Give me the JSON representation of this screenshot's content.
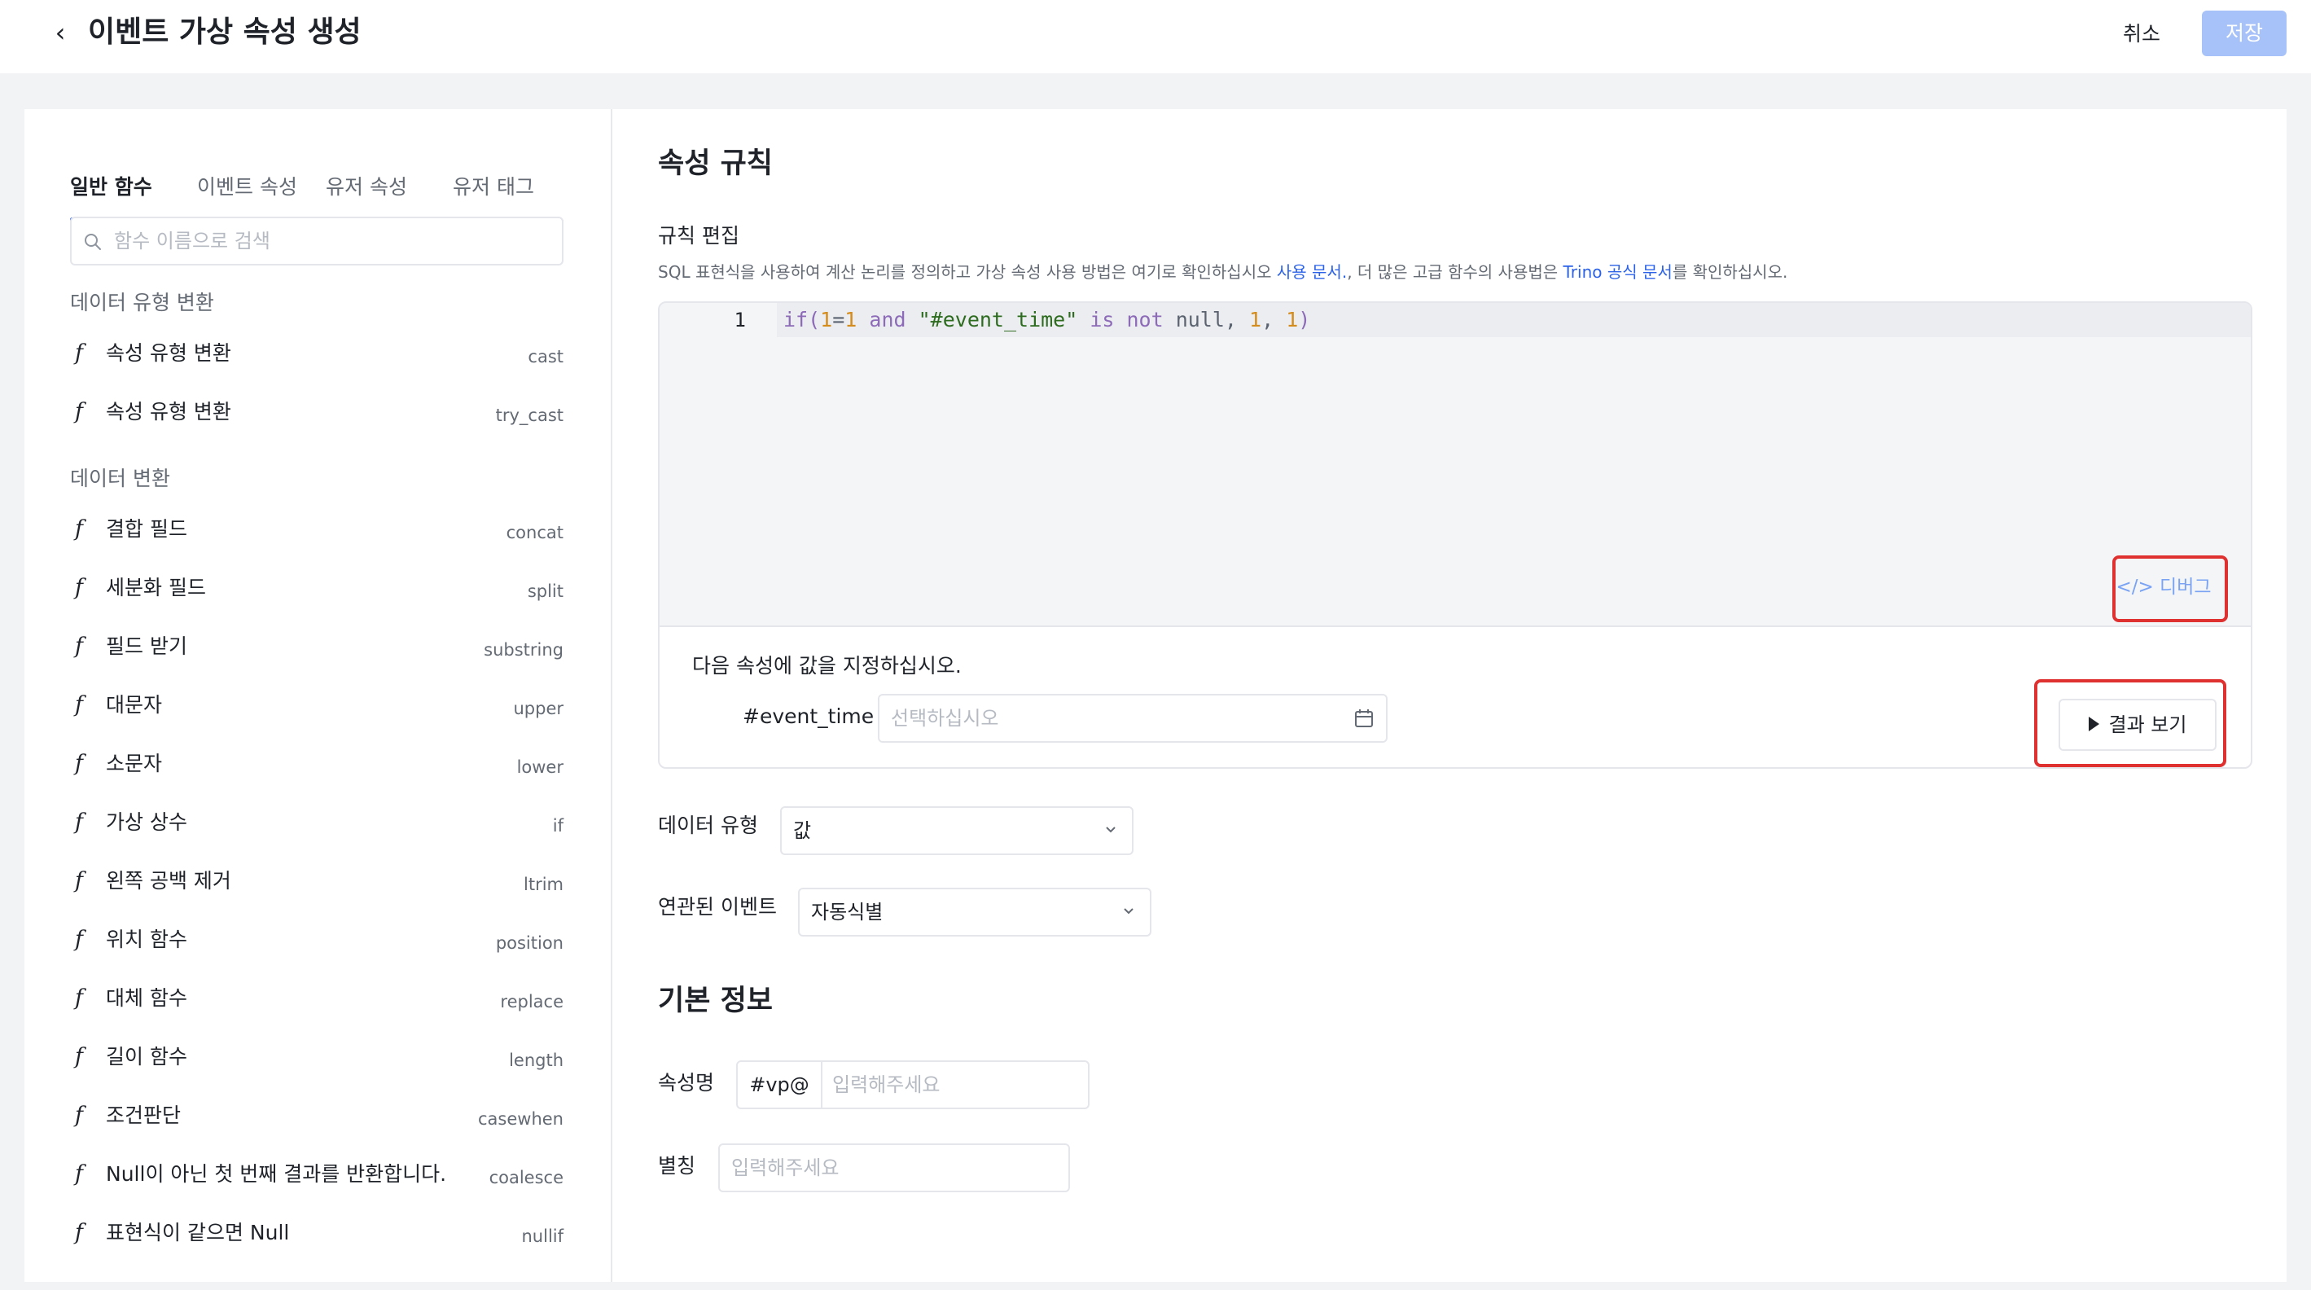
{
  "header": {
    "back_icon": "chevron-left-icon",
    "title": "이벤트 가상 속성 생성",
    "cancel_label": "취소",
    "save_label": "저장",
    "save_color": "#a7c2f8"
  },
  "left": {
    "tabs": [
      {
        "label": "일반 함수",
        "active": true
      },
      {
        "label": "이벤트 속성",
        "active": false
      },
      {
        "label": "유저 속성",
        "active": false
      },
      {
        "label": "유저 태그",
        "active": false
      }
    ],
    "search": {
      "placeholder": "함수 이름으로 검색",
      "icon": "search-icon"
    },
    "categories": [
      {
        "label": "데이터 유형 변환",
        "items": [
          {
            "f": "f",
            "name": "속성 유형 변환",
            "code": "cast"
          },
          {
            "f": "f",
            "name": "속성 유형 변환",
            "code": "try_cast"
          }
        ]
      },
      {
        "label": "데이터 변환",
        "items": [
          {
            "f": "f",
            "name": "결합 필드",
            "code": "concat"
          },
          {
            "f": "f",
            "name": "세분화 필드",
            "code": "split"
          },
          {
            "f": "f",
            "name": "필드 받기",
            "code": "substring"
          },
          {
            "f": "f",
            "name": "대문자",
            "code": "upper"
          },
          {
            "f": "f",
            "name": "소문자",
            "code": "lower"
          },
          {
            "f": "f",
            "name": "가상 상수",
            "code": "if"
          },
          {
            "f": "f",
            "name": "왼쪽 공백 제거",
            "code": "ltrim"
          },
          {
            "f": "f",
            "name": "위치 함수",
            "code": "position"
          },
          {
            "f": "f",
            "name": "대체 함수",
            "code": "replace"
          },
          {
            "f": "f",
            "name": "길이 함수",
            "code": "length"
          },
          {
            "f": "f",
            "name": "조건판단",
            "code": "casewhen"
          },
          {
            "f": "f",
            "name": "Null이 아닌 첫 번째 결과를 반환합니다.",
            "code": "coalesce"
          },
          {
            "f": "f",
            "name": "표현식이 같으면 Null",
            "code": "nullif"
          }
        ]
      }
    ]
  },
  "rule": {
    "title": "속성 규칙",
    "edit_label": "규칙 편집",
    "desc_before": "SQL 표현식을 사용하여 계산 논리를 정의하고 가상 속성 사용 방법은 여기로 확인하십시오 ",
    "desc_link1": "사용 문서.",
    "desc_middle": ", 더 많은 고급 함수의 사용법은 ",
    "desc_link2": "Trino 공식 문서",
    "desc_after": "를 확인하십시오.",
    "link_color": "#2b62e8",
    "line_number": "1",
    "code": {
      "t1": "if(",
      "t2": "1",
      "t3": "=",
      "t4": "1",
      "t5": " and ",
      "t6": "\"#event_time\"",
      "t7": " is not ",
      "t8": "null, ",
      "t9": "1",
      "t10": ", ",
      "t11": "1",
      "t12": ")"
    },
    "debug_label": "</> 디버그",
    "assign_label": "다음 속성에 값을 지정하십시오.",
    "param_name": "#event_time",
    "param_placeholder": "선택하십시오",
    "calendar_icon": "calendar-icon",
    "result_label": "결과 보기",
    "play_icon": "play-icon",
    "highlight_color": "#e03131"
  },
  "settings": {
    "data_type_label": "데이터 유형",
    "data_type_value": "값",
    "event_label": "연관된 이벤트",
    "event_value": "자동식별"
  },
  "basic": {
    "title": "기본 정보",
    "name_label": "속성명",
    "name_prefix": "#vp@",
    "name_placeholder": "입력해주세요",
    "alias_label": "별칭",
    "alias_placeholder": "입력해주세요"
  }
}
